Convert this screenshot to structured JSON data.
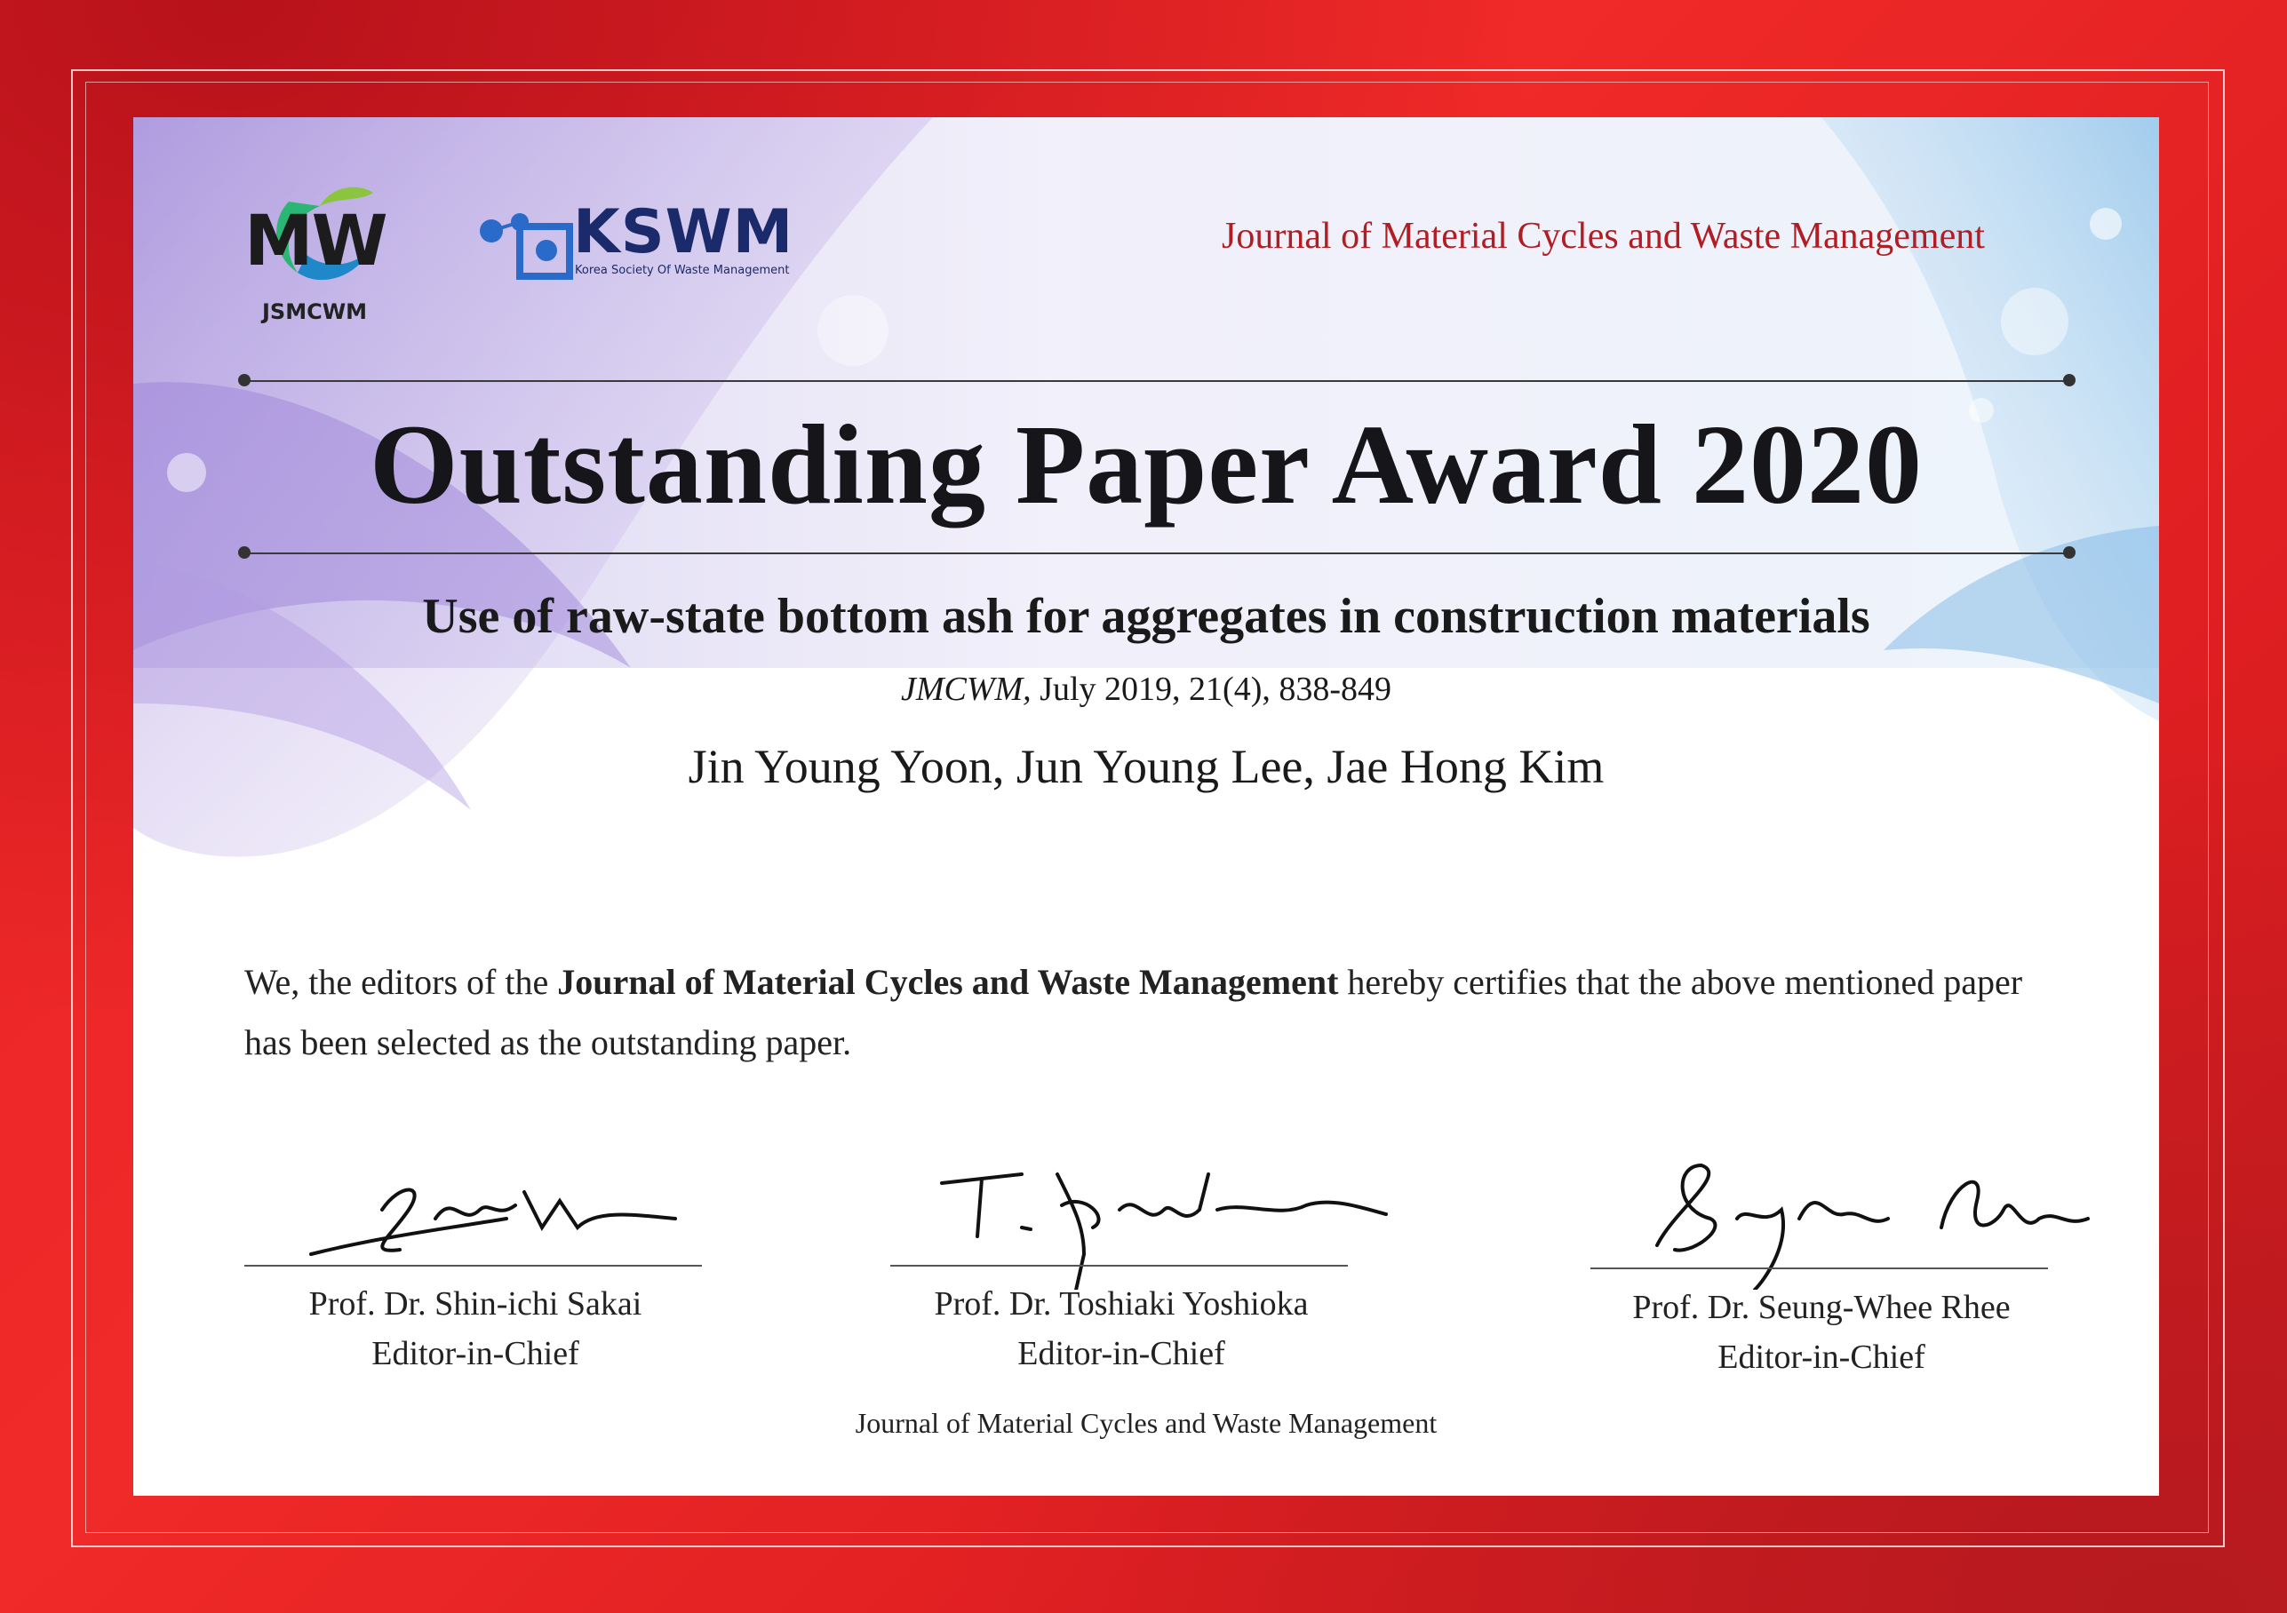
{
  "logos": {
    "jsmcwm_mark": "MW",
    "jsmcwm_label": "JSMCWM",
    "kswm_mark": "KSWM",
    "kswm_label": "Korea Society Of Waste Management"
  },
  "header": {
    "journal": "Journal of Material Cycles and Waste Management"
  },
  "award": {
    "title": "Outstanding Paper Award 2020",
    "paper_title": "Use of raw-state bottom ash for aggregates in construction materials",
    "citation_journal": "JMCWM,",
    "citation_details": " July 2019, 21(4), 838-849",
    "authors": "Jin Young Yoon, Jun Young Lee, Jae Hong Kim"
  },
  "statement": {
    "part1": "We, the editors of the ",
    "journal_bold": "Journal of Material Cycles and Waste Management",
    "part2": " hereby certifies that the above mentioned paper has been selected as the outstanding paper."
  },
  "signatories": [
    {
      "name": "Prof. Dr. Shin-ichi Sakai",
      "title": "Editor-in-Chief"
    },
    {
      "name": "Prof. Dr. Toshiaki Yoshioka",
      "title": "Editor-in-Chief"
    },
    {
      "name": "Prof. Dr. Seung-Whee Rhee",
      "title": "Editor-in-Chief"
    }
  ],
  "footer": {
    "journal": "Journal of Material Cycles and Waste Management"
  },
  "colors": {
    "border_red": "#e82226",
    "header_red": "#b01e24",
    "kswm_blue": "#1a2a6a",
    "decor_purple": "#9b7fd6",
    "decor_blue": "#7fb8e6"
  }
}
